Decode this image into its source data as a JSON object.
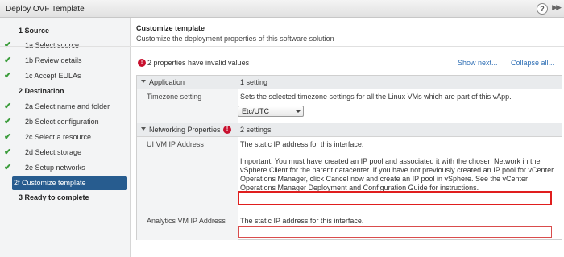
{
  "window": {
    "title": "Deploy OVF Template"
  },
  "sidebar": {
    "steps": [
      {
        "num": "1",
        "label": "Source",
        "type": "section",
        "done": false
      },
      {
        "num": "1a",
        "label": "Select source",
        "type": "sub",
        "done": true
      },
      {
        "num": "1b",
        "label": "Review details",
        "type": "sub",
        "done": true
      },
      {
        "num": "1c",
        "label": "Accept EULAs",
        "type": "sub",
        "done": true
      },
      {
        "num": "2",
        "label": "Destination",
        "type": "section",
        "done": false
      },
      {
        "num": "2a",
        "label": "Select name and folder",
        "type": "sub",
        "done": true
      },
      {
        "num": "2b",
        "label": "Select configuration",
        "type": "sub",
        "done": true
      },
      {
        "num": "2c",
        "label": "Select a resource",
        "type": "sub",
        "done": true
      },
      {
        "num": "2d",
        "label": "Select storage",
        "type": "sub",
        "done": true
      },
      {
        "num": "2e",
        "label": "Setup networks",
        "type": "sub",
        "done": true
      },
      {
        "num": "2f",
        "label": "Customize template",
        "type": "sub",
        "done": false,
        "active": true
      },
      {
        "num": "3",
        "label": "Ready to complete",
        "type": "section",
        "done": false
      }
    ]
  },
  "main": {
    "title": "Customize template",
    "subtitle": "Customize the deployment properties of this software solution",
    "warning": "2 properties have invalid values",
    "show_next": "Show next...",
    "collapse_all": "Collapse all...",
    "groups": [
      {
        "name": "Application",
        "summary": "1 setting",
        "props": [
          {
            "key": "Timezone setting",
            "desc": "Sets the selected timezone settings for all the Linux VMs which are part of this vApp.",
            "select_value": "Etc/UTC"
          }
        ]
      },
      {
        "name": "Networking Properties",
        "summary": "2 settings",
        "invalid": true,
        "props": [
          {
            "key": "UI VM IP Address",
            "desc": "The static IP address for this interface.",
            "note": "Important: You must have created an IP pool and associated it with the chosen Network in the vSphere Client for the parent datacenter. If you have not previously created an IP pool for vCenter Operations Manager, click Cancel now and create an IP pool in vSphere. See the vCenter Operations Manager Deployment and Configuration Guide for instructions.",
            "value": ""
          },
          {
            "key": "Analytics VM IP Address",
            "desc": "The static IP address for this interface.",
            "value": ""
          }
        ]
      }
    ]
  },
  "colors": {
    "accent": "#275c8f",
    "error": "#e01e1e",
    "check": "#3b9c3b",
    "link": "#2f6fb5"
  }
}
